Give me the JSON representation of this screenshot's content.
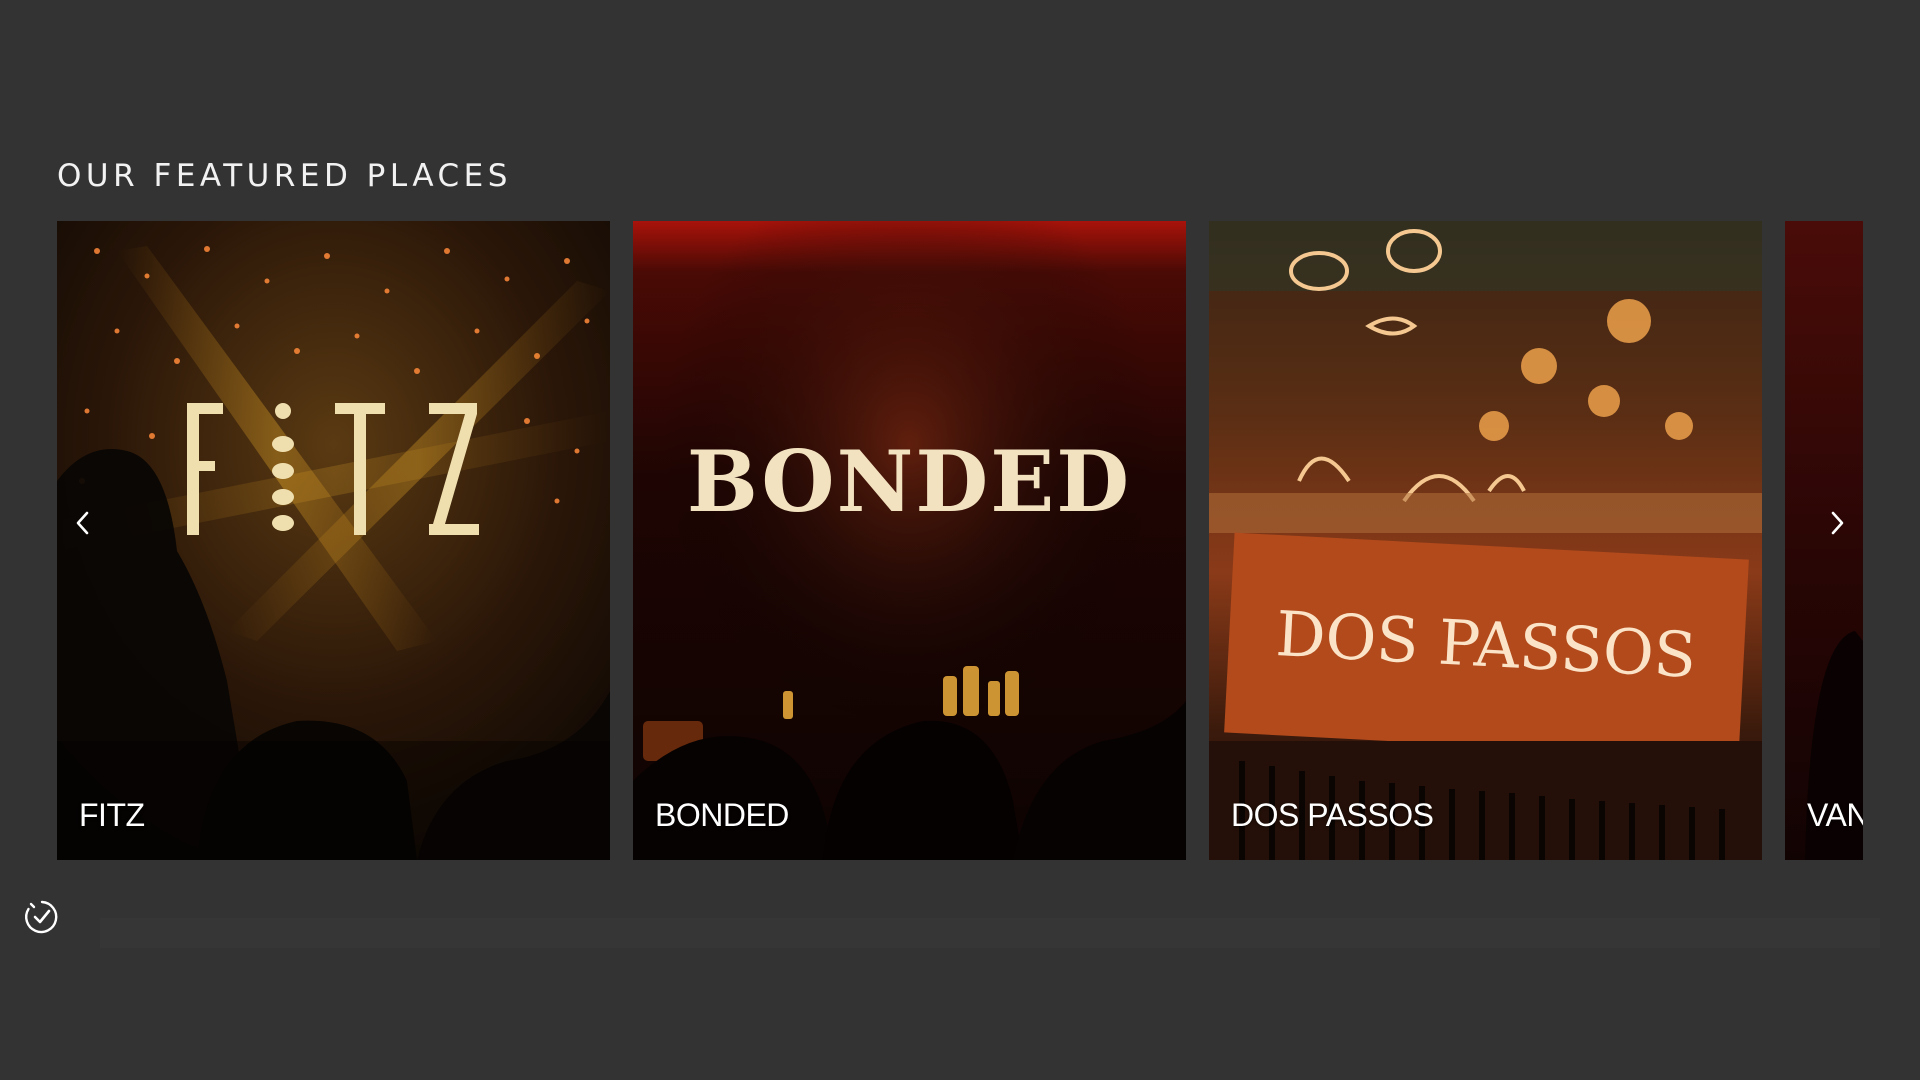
{
  "section": {
    "title": "OUR FEATURED PLACES"
  },
  "places": [
    {
      "name": "FITZ",
      "sign": "FITZ"
    },
    {
      "name": "BONDED",
      "sign": "BONDED"
    },
    {
      "name": "DOS PASSOS",
      "sign": "DOS PASSOS"
    },
    {
      "name": "VAN"
    }
  ],
  "icons": {
    "prev": "chevron-left-icon",
    "next": "chevron-right-icon",
    "badge": "clock-check-icon"
  },
  "colors": {
    "background": "#333333",
    "label": "#ffffff",
    "accent_gold": "#f0dfae",
    "accent_red": "#c0401c"
  }
}
